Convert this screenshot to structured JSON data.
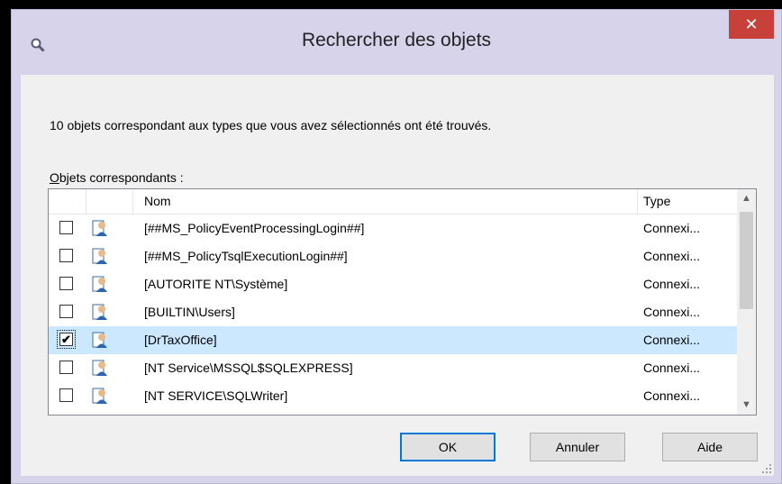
{
  "dialog": {
    "title": "Rechercher des objets",
    "close_glyph": "✕",
    "message": "10 objets correspondant aux types que vous avez sélectionnés ont été trouvés.",
    "list_label_accel": "O",
    "list_label_rest": "bjets correspondants :"
  },
  "columns": {
    "name": "Nom",
    "type": "Type"
  },
  "rows": [
    {
      "name": "[##MS_PolicyEventProcessingLogin##]",
      "type": "Connexi...",
      "checked": false,
      "check_glyph": ""
    },
    {
      "name": "[##MS_PolicyTsqlExecutionLogin##]",
      "type": "Connexi...",
      "checked": false,
      "check_glyph": ""
    },
    {
      "name": "[AUTORITE NT\\Système]",
      "type": "Connexi...",
      "checked": false,
      "check_glyph": ""
    },
    {
      "name": "[BUILTIN\\Users]",
      "type": "Connexi...",
      "checked": false,
      "check_glyph": ""
    },
    {
      "name": "[DrTaxOffice]",
      "type": "Connexi...",
      "checked": true,
      "check_glyph": "✔"
    },
    {
      "name": "[NT Service\\MSSQL$SQLEXPRESS]",
      "type": "Connexi...",
      "checked": false,
      "check_glyph": ""
    },
    {
      "name": "[NT SERVICE\\SQLWriter]",
      "type": "Connexi...",
      "checked": false,
      "check_glyph": ""
    }
  ],
  "buttons": {
    "ok": "OK",
    "cancel": "Annuler",
    "help": "Aide"
  },
  "scrollbar": {
    "up_glyph": "▲",
    "down_glyph": "▼"
  },
  "icons": {
    "title": "search-icon",
    "row": "user-login-icon",
    "close": "close-icon",
    "grip": "resize-grip-icon"
  },
  "colors": {
    "titlebar": "#d6d3eb",
    "close": "#c7413a",
    "selection": "#cce8ff",
    "default_border": "#0078d7"
  }
}
